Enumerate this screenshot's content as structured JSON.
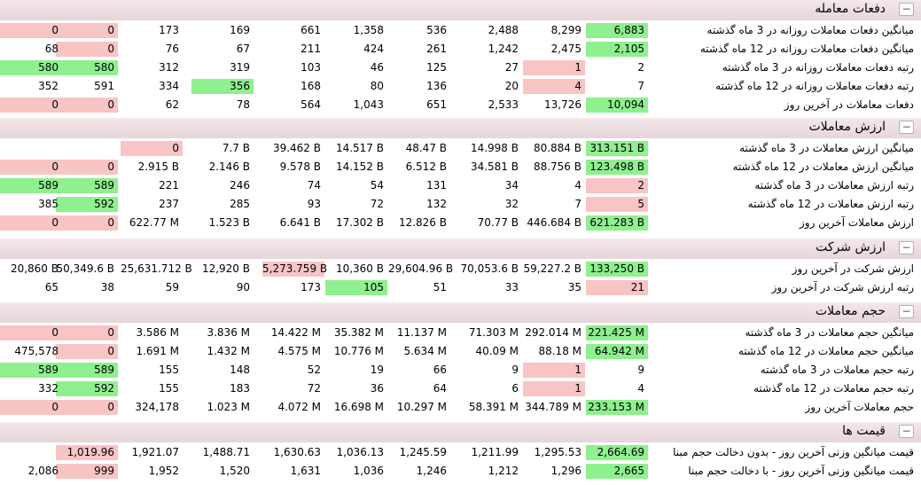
{
  "sections": [
    {
      "title": "دفعات معامله",
      "rows": [
        {
          "label": "میانگین دفعات معاملات روزانه در 3 ماه گذشته",
          "cells": [
            {
              "v": "6,883",
              "c": "green"
            },
            {
              "v": "8,299"
            },
            {
              "v": "2,488"
            },
            {
              "v": "536"
            },
            {
              "v": "1,358"
            },
            {
              "v": "661"
            },
            {
              "v": "169"
            },
            {
              "v": "173"
            },
            {
              "v": "0",
              "c": "pink"
            },
            {
              "v": "0",
              "c": "pink"
            }
          ]
        },
        {
          "label": "میانگین دفعات معاملات روزانه در 12 ماه گذشته",
          "cells": [
            {
              "v": "2,105",
              "c": "green"
            },
            {
              "v": "2,475"
            },
            {
              "v": "1,242"
            },
            {
              "v": "261"
            },
            {
              "v": "424"
            },
            {
              "v": "211"
            },
            {
              "v": "67"
            },
            {
              "v": "76"
            },
            {
              "v": "0",
              "c": "pink"
            },
            {
              "v": "68"
            }
          ]
        },
        {
          "label": "رتبه دفعات معاملات روزانه در 3 ماه گذشته",
          "cells": [
            {
              "v": "2"
            },
            {
              "v": "1",
              "c": "pink"
            },
            {
              "v": "27"
            },
            {
              "v": "125"
            },
            {
              "v": "46"
            },
            {
              "v": "103"
            },
            {
              "v": "319"
            },
            {
              "v": "312"
            },
            {
              "v": "580",
              "c": "green"
            },
            {
              "v": "580",
              "c": "green"
            }
          ]
        },
        {
          "label": "رتبه دفعات معاملات روزانه در 12 ماه گذشته",
          "cells": [
            {
              "v": "7"
            },
            {
              "v": "4",
              "c": "pink"
            },
            {
              "v": "20"
            },
            {
              "v": "136"
            },
            {
              "v": "80"
            },
            {
              "v": "168"
            },
            {
              "v": "356",
              "c": "green"
            },
            {
              "v": "334"
            },
            {
              "v": "591"
            },
            {
              "v": "352"
            }
          ]
        },
        {
          "label": "دفعات معاملات در آخرین روز",
          "cells": [
            {
              "v": "10,094",
              "c": "green"
            },
            {
              "v": "13,726"
            },
            {
              "v": "2,533"
            },
            {
              "v": "651"
            },
            {
              "v": "1,043"
            },
            {
              "v": "564"
            },
            {
              "v": "78"
            },
            {
              "v": "62"
            },
            {
              "v": "0",
              "c": "pink"
            },
            {
              "v": "0",
              "c": "pink"
            }
          ]
        }
      ]
    },
    {
      "title": "ارزش معاملات",
      "rows": [
        {
          "label": "میانگین ارزش معاملات در 3 ماه گذشته",
          "cells": [
            {
              "v": "313.151 B",
              "c": "green"
            },
            {
              "v": "80.884 B"
            },
            {
              "v": "14.998 B"
            },
            {
              "v": "48.47 B"
            },
            {
              "v": "14.517 B"
            },
            {
              "v": "39.462 B"
            },
            {
              "v": "7.7 B"
            },
            {
              "v": "0",
              "c": "pink"
            },
            {
              "v": ""
            },
            {
              "v": ""
            }
          ]
        },
        {
          "label": "میانگین ارزش معاملات در 12 ماه گذشته",
          "cells": [
            {
              "v": "123.498 B",
              "c": "green"
            },
            {
              "v": "88.756 B"
            },
            {
              "v": "34.581 B"
            },
            {
              "v": "6.512 B"
            },
            {
              "v": "14.152 B"
            },
            {
              "v": "9.578 B"
            },
            {
              "v": "2.146 B"
            },
            {
              "v": "2.915 B"
            },
            {
              "v": "0",
              "c": "pink"
            },
            {
              "v": "0",
              "c": "pink"
            }
          ]
        },
        {
          "label": "رتبه ارزش معاملات در 3 ماه گذشته",
          "cells": [
            {
              "v": "2",
              "c": "pink"
            },
            {
              "v": "4"
            },
            {
              "v": "34"
            },
            {
              "v": "131"
            },
            {
              "v": "54"
            },
            {
              "v": "74"
            },
            {
              "v": "246"
            },
            {
              "v": "221"
            },
            {
              "v": "589",
              "c": "green"
            },
            {
              "v": "589",
              "c": "green"
            }
          ]
        },
        {
          "label": "رتبه ارزش معاملات در 12 ماه گذشته",
          "cells": [
            {
              "v": "5",
              "c": "pink"
            },
            {
              "v": "7"
            },
            {
              "v": "32"
            },
            {
              "v": "132"
            },
            {
              "v": "72"
            },
            {
              "v": "93"
            },
            {
              "v": "285"
            },
            {
              "v": "237"
            },
            {
              "v": "592",
              "c": "green"
            },
            {
              "v": "385"
            }
          ]
        },
        {
          "label": "ارزش معاملات آخرین روز",
          "cells": [
            {
              "v": "621.283 B",
              "c": "green"
            },
            {
              "v": "446.684 B"
            },
            {
              "v": "70.77 B"
            },
            {
              "v": "12.826 B"
            },
            {
              "v": "17.302 B"
            },
            {
              "v": "6.641 B"
            },
            {
              "v": "1.523 B"
            },
            {
              "v": "622.77 M"
            },
            {
              "v": "0",
              "c": "pink"
            },
            {
              "v": "0",
              "c": "pink"
            }
          ]
        }
      ]
    },
    {
      "title": "ارزش شرکت",
      "rows": [
        {
          "label": "ارزش شرکت در آخرین روز",
          "cells": [
            {
              "v": "133,250 B",
              "c": "green"
            },
            {
              "v": "59,227.2 B"
            },
            {
              "v": "70,053.6 B"
            },
            {
              "v": "29,604.96 B"
            },
            {
              "v": "10,360 B"
            },
            {
              "v": "5,273.759 B",
              "c": "pink"
            },
            {
              "v": "12,920 B"
            },
            {
              "v": "25,631.712 B"
            },
            {
              "v": "50,349.6 B"
            },
            {
              "v": "20,860 B"
            }
          ]
        },
        {
          "label": "رتبه ارزش شرکت در آخرین روز",
          "cells": [
            {
              "v": "21",
              "c": "pink"
            },
            {
              "v": "35"
            },
            {
              "v": "33"
            },
            {
              "v": "51"
            },
            {
              "v": "105",
              "c": "green"
            },
            {
              "v": "173"
            },
            {
              "v": "90"
            },
            {
              "v": "59"
            },
            {
              "v": "38"
            },
            {
              "v": "65"
            }
          ]
        }
      ]
    },
    {
      "title": "حجم معاملات",
      "rows": [
        {
          "label": "میانگین حجم معاملات در 3 ماه گذشته",
          "cells": [
            {
              "v": "221.425 M",
              "c": "green"
            },
            {
              "v": "292.014 M"
            },
            {
              "v": "71.303 M"
            },
            {
              "v": "11.137 M"
            },
            {
              "v": "35.382 M"
            },
            {
              "v": "14.422 M"
            },
            {
              "v": "3.836 M"
            },
            {
              "v": "3.586 M"
            },
            {
              "v": "0",
              "c": "pink"
            },
            {
              "v": "0",
              "c": "pink"
            }
          ]
        },
        {
          "label": "میانگین حجم معاملات در 12 ماه گذشته",
          "cells": [
            {
              "v": "64.942 M",
              "c": "green"
            },
            {
              "v": "88.18 M"
            },
            {
              "v": "40.09 M"
            },
            {
              "v": "5.634 M"
            },
            {
              "v": "10.776 M"
            },
            {
              "v": "4.575 M"
            },
            {
              "v": "1.432 M"
            },
            {
              "v": "1.691 M"
            },
            {
              "v": "0",
              "c": "pink"
            },
            {
              "v": "475,578"
            }
          ]
        },
        {
          "label": "رتبه حجم معاملات در 3 ماه گذشته",
          "cells": [
            {
              "v": "9"
            },
            {
              "v": "1",
              "c": "pink"
            },
            {
              "v": "9"
            },
            {
              "v": "66"
            },
            {
              "v": "19"
            },
            {
              "v": "52"
            },
            {
              "v": "148"
            },
            {
              "v": "155"
            },
            {
              "v": "589",
              "c": "green"
            },
            {
              "v": "589",
              "c": "green"
            }
          ]
        },
        {
          "label": "رتبه حجم معاملات در 12 ماه گذشته",
          "cells": [
            {
              "v": "4"
            },
            {
              "v": "1",
              "c": "pink"
            },
            {
              "v": "6"
            },
            {
              "v": "64"
            },
            {
              "v": "36"
            },
            {
              "v": "72"
            },
            {
              "v": "183"
            },
            {
              "v": "155"
            },
            {
              "v": "592",
              "c": "green"
            },
            {
              "v": "332"
            }
          ]
        },
        {
          "label": "حجم معاملات آخرین روز",
          "cells": [
            {
              "v": "233.153 M",
              "c": "green"
            },
            {
              "v": "344.789 M"
            },
            {
              "v": "58.391 M"
            },
            {
              "v": "10.297 M"
            },
            {
              "v": "16.698 M"
            },
            {
              "v": "4.072 M"
            },
            {
              "v": "1.023 M"
            },
            {
              "v": "324,178"
            },
            {
              "v": "0",
              "c": "pink"
            },
            {
              "v": "0",
              "c": "pink"
            }
          ]
        }
      ]
    },
    {
      "title": "قیمت ها",
      "rows": [
        {
          "label": "قیمت میانگین وزنی آخرین روز - بدون دخالت حجم مبنا",
          "cells": [
            {
              "v": "2,664.69",
              "c": "green"
            },
            {
              "v": "1,295.53"
            },
            {
              "v": "1,211.99"
            },
            {
              "v": "1,245.59"
            },
            {
              "v": "1,036.13"
            },
            {
              "v": "1,630.63"
            },
            {
              "v": "1,488.71"
            },
            {
              "v": "1,921.07"
            },
            {
              "v": "1,019.96",
              "c": "pink"
            },
            {
              "v": ""
            }
          ]
        },
        {
          "label": "قیمت میانگین وزنی آخرین روز - با دخالت حجم مبنا",
          "cells": [
            {
              "v": "2,665",
              "c": "green"
            },
            {
              "v": "1,296"
            },
            {
              "v": "1,212"
            },
            {
              "v": "1,246"
            },
            {
              "v": "1,036"
            },
            {
              "v": "1,631"
            },
            {
              "v": "1,520"
            },
            {
              "v": "1,952"
            },
            {
              "v": "999",
              "c": "pink"
            },
            {
              "v": "2,086"
            }
          ]
        }
      ]
    }
  ],
  "collapse_symbol": "−"
}
